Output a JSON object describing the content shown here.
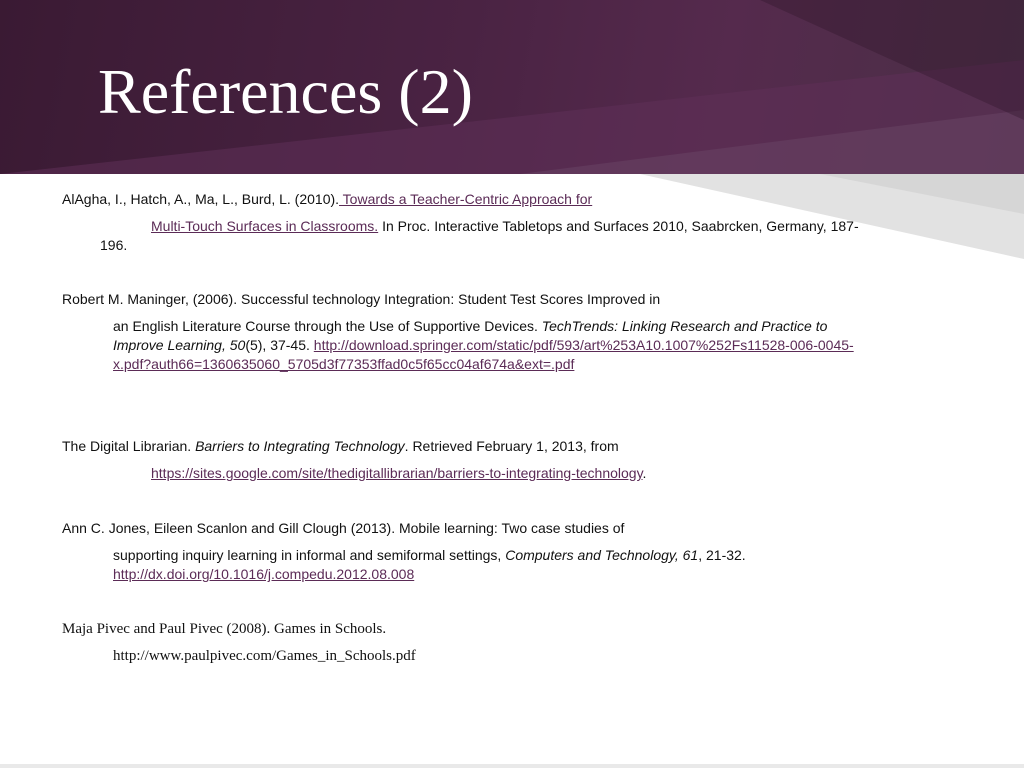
{
  "title": "References (2)",
  "refs": {
    "r1": {
      "l1_text": "AlAgha, I., Hatch, A., Ma, L., Burd, L. (2010).",
      "l1_link": " Towards a Teacher-Centric Approach for",
      "l2_link": "Multi-Touch Surfaces in Classrooms.",
      "l2_text": " In Proc. Interactive Tabletops and Surfaces 2010, Saabrcken, Germany, 187-",
      "l3_text": "196."
    },
    "r2": {
      "l1_text": "Robert M. Maninger, (2006). Successful technology Integration: Student Test Scores Improved in",
      "l2_text": "an English Literature Course through the Use of Supportive Devices. ",
      "l2_italic": "TechTrends: Linking Research and Practice to",
      "l3_italic": "Improve Learning, 50",
      "l3_text": "(5), 37-45. ",
      "l3_link": "http://download.springer.com/static/pdf/593/art%253A10.1007%252Fs11528-006-0045-",
      "l4_link": "x.pdf?auth66=1360635060_5705d3f77353ffad0c5f65cc04af674a&ext=.pdf"
    },
    "r3": {
      "l1_text": "The Digital Librarian. ",
      "l1_italic": "Barriers to Integrating Technology",
      "l1_text2": ". Retrieved February 1, 2013, from",
      "l2_link": "https://sites.google.com/site/thedigitallibrarian/barriers-to-integrating-technology",
      "l2_text": "."
    },
    "r4": {
      "l1_text": "Ann C. Jones, Eileen Scanlon and Gill Clough (2013). Mobile learning: Two case studies of",
      "l2_text": "supporting inquiry learning in informal and semiformal settings, ",
      "l2_italic": "Computers and Technology, 61",
      "l2_text2": ", 21-32.",
      "l3_link": "http://dx.doi.org/10.1016/j.compedu.2012.08.008"
    },
    "r5": {
      "l1_text": "Maja Pivec and Paul Pivec (2008). Games in Schools.",
      "l2_text": "http://www.paulpivec.com/Games_in_Schools.pdf"
    }
  }
}
